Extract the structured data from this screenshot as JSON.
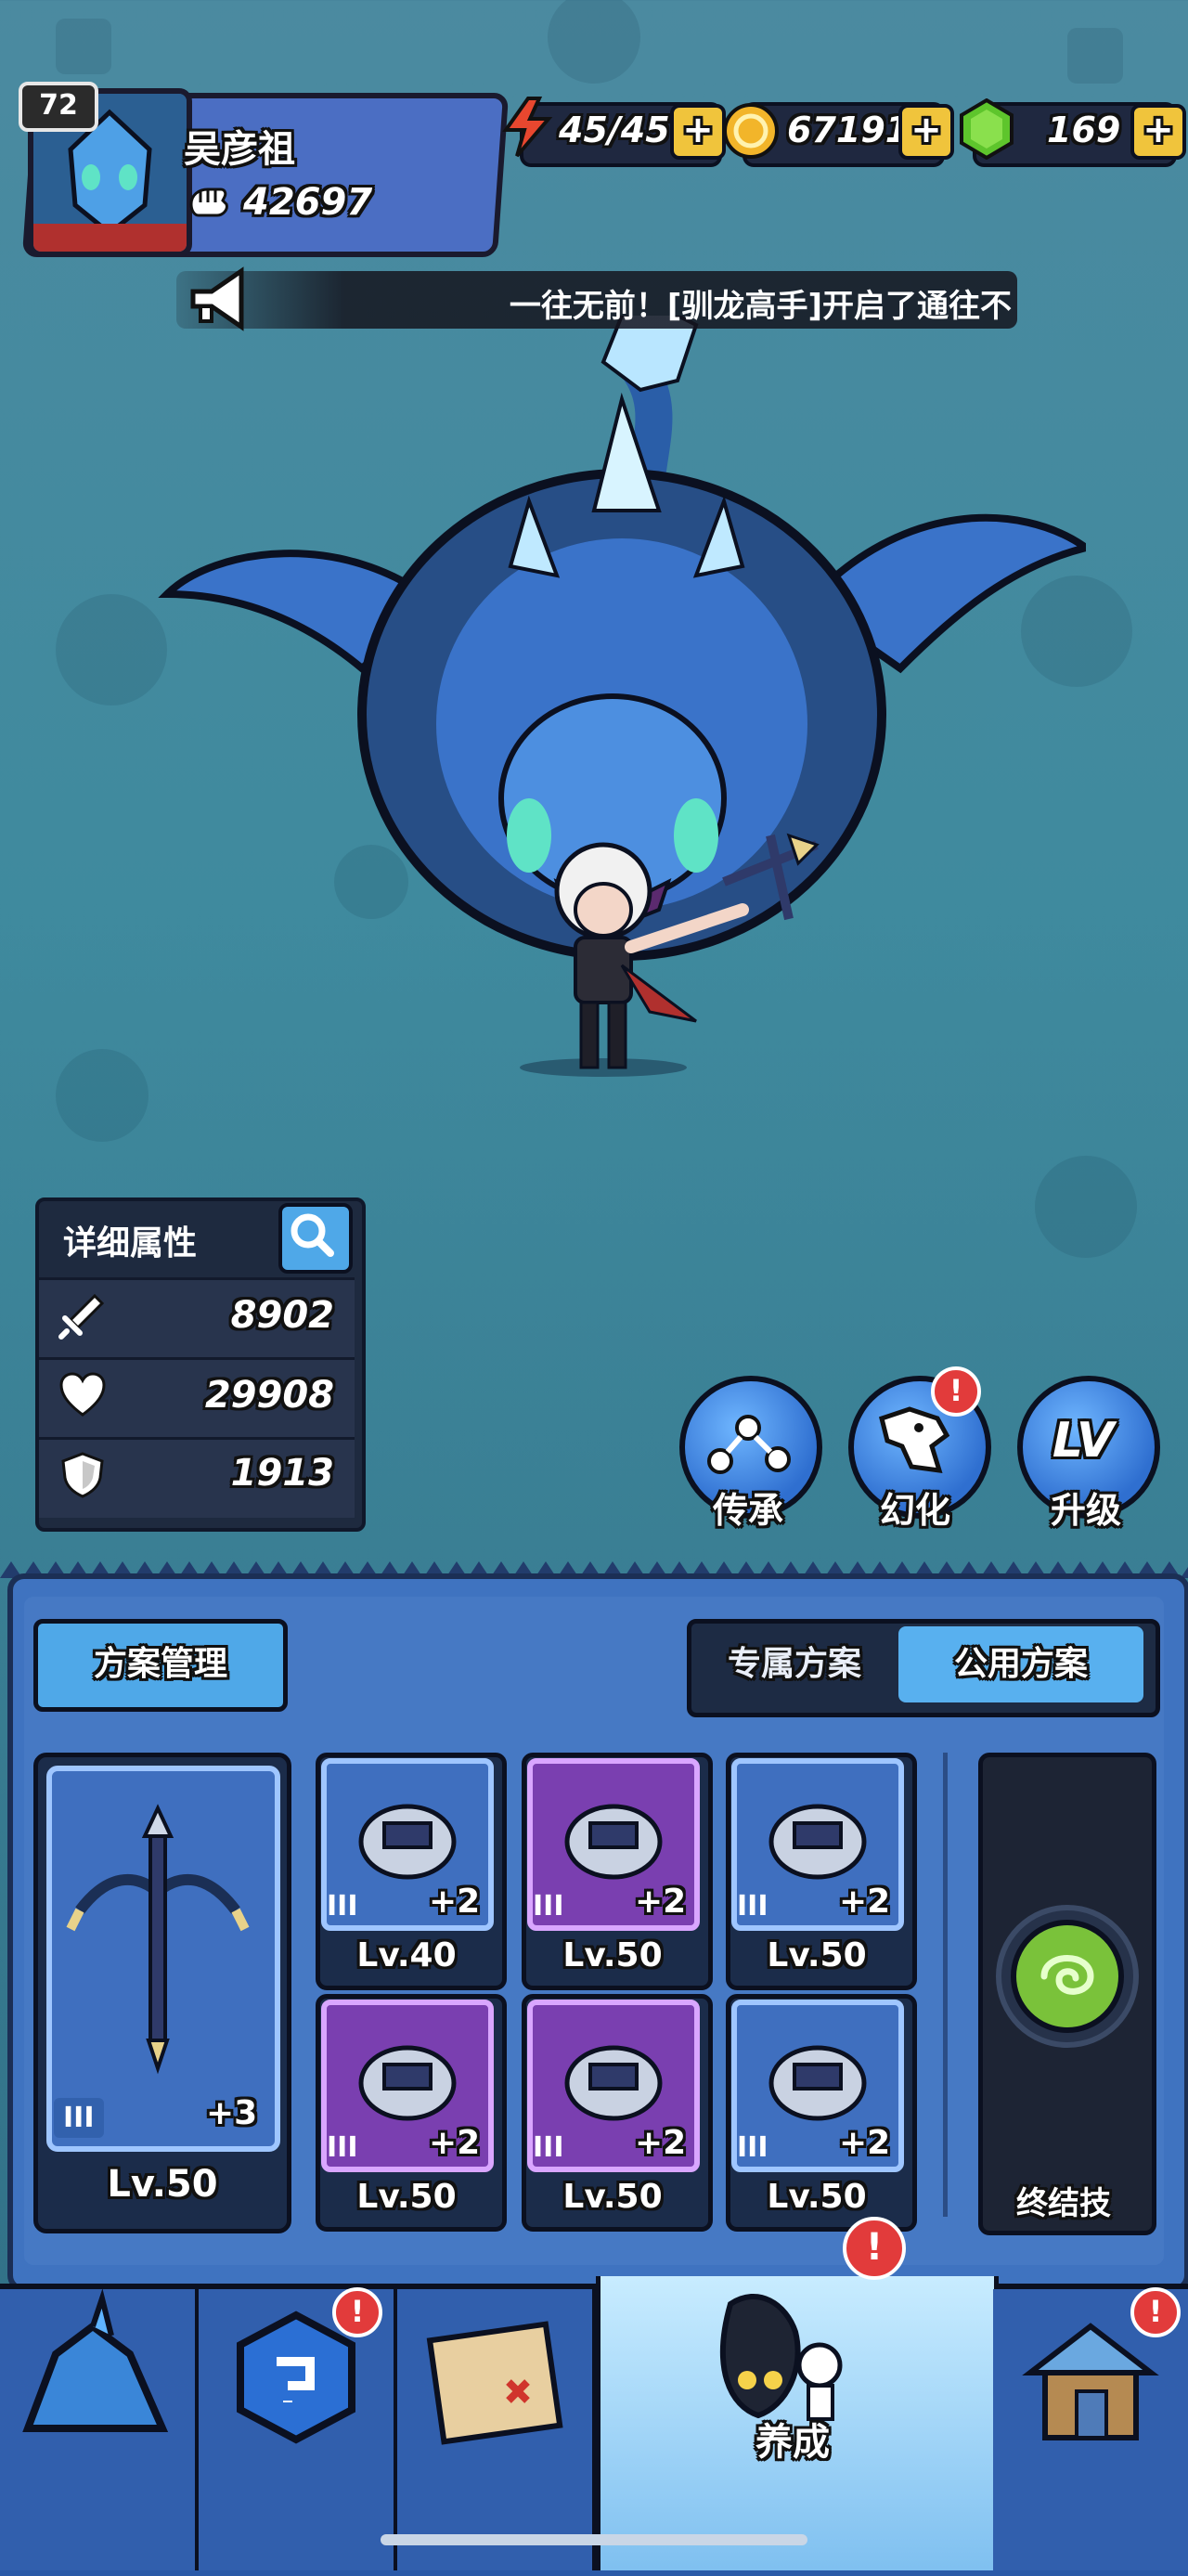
{
  "player": {
    "level": "72",
    "name": "吴彦祖",
    "power": "42697"
  },
  "resources": {
    "energy": {
      "value": "45/45",
      "icon": "lightning-icon"
    },
    "gold": {
      "value": "67191",
      "icon": "gold-coin-icon"
    },
    "gem": {
      "value": "169",
      "icon": "green-gem-icon"
    },
    "plus_label": "+"
  },
  "announcement": {
    "text": "一往无前！[驯龙高手]开启了通往不"
  },
  "stats": {
    "title": "详细属性",
    "attack": "8902",
    "health": "29908",
    "defense": "1913"
  },
  "actions": {
    "inherit": "传承",
    "transform": "幻化",
    "upgrade": "升级",
    "upgrade_icon_text": "LV",
    "alert_mark": "!"
  },
  "panel": {
    "scheme_manage": "方案管理",
    "tab_exclusive": "专属方案",
    "tab_public": "公用方案",
    "weapon": {
      "tier": "III",
      "plus": "+3",
      "level": "Lv.50"
    },
    "slots": [
      {
        "tier": "III",
        "plus": "+2",
        "level": "Lv.40",
        "rarity": "blue",
        "icon": "helmet-icon"
      },
      {
        "tier": "III",
        "plus": "+2",
        "level": "Lv.50",
        "rarity": "purple",
        "icon": "armor-icon"
      },
      {
        "tier": "III",
        "plus": "+2",
        "level": "Lv.50",
        "rarity": "blue",
        "icon": "pants-icon"
      },
      {
        "tier": "III",
        "plus": "+2",
        "level": "Lv.50",
        "rarity": "purple",
        "icon": "gauntlet-icon"
      },
      {
        "tier": "III",
        "plus": "+2",
        "level": "Lv.50",
        "rarity": "purple",
        "icon": "boots-icon"
      },
      {
        "tier": "III",
        "plus": "+2",
        "level": "Lv.50",
        "rarity": "blue",
        "icon": "necklace-icon"
      }
    ],
    "ultimate_label": "终结技"
  },
  "nav": {
    "active_label": "养成"
  },
  "colors": {
    "accent_blue": "#4fa8e8",
    "gold": "#f0c43c",
    "alert_red": "#e23b3b",
    "purple_rarity": "#7a3fb0"
  }
}
